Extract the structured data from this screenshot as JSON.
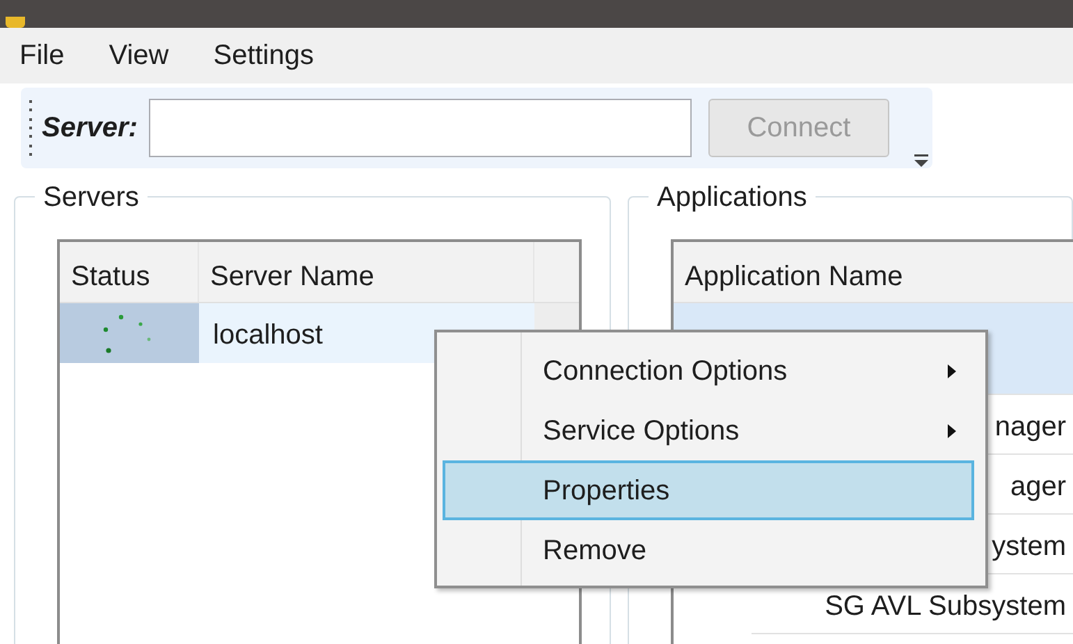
{
  "menu_bar": [
    "File",
    "View",
    "Settings"
  ],
  "toolbar": {
    "label": "Server:",
    "connect": {
      "label": "Connect",
      "disabled": true
    }
  },
  "servers": {
    "title": "Servers",
    "columns": [
      "Status",
      "Server Name"
    ],
    "rows": [
      {
        "server_name": "localhost",
        "selected": true
      }
    ]
  },
  "applications": {
    "title": "Applications",
    "columns": [
      "Application Name"
    ],
    "rows": [
      {
        "selected": true
      },
      {
        "name": "nager",
        "selected": false
      },
      {
        "name": "ager",
        "selected": false
      },
      {
        "name": "ystem",
        "selected": false
      },
      {
        "name": "SG AVL Subsystem",
        "selected": false
      }
    ]
  },
  "context_menu": [
    {
      "label": "Connection Options",
      "submenu": true,
      "selected": false
    },
    {
      "label": "Service Options",
      "submenu": true,
      "selected": false
    },
    {
      "label": "Properties",
      "submenu": false,
      "selected": true
    },
    {
      "label": "Remove",
      "submenu": false,
      "selected": false
    }
  ]
}
